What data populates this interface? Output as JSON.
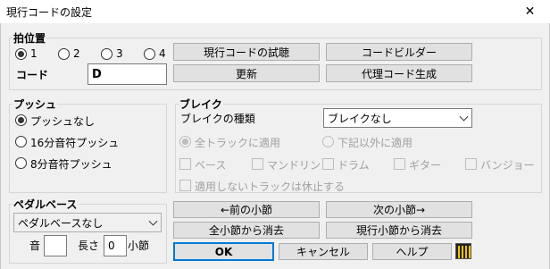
{
  "window": {
    "title": "現行コードの設定",
    "close_glyph": "✕"
  },
  "beat_position": {
    "group_label": "拍位置",
    "options": [
      "1",
      "2",
      "3",
      "4"
    ],
    "selected_index": 0,
    "code_label": "コード",
    "code_value": "D"
  },
  "top_buttons": {
    "trial": "現行コードの試聴",
    "code_builder": "コードビルダー",
    "update": "更新",
    "substitute": "代理コード生成"
  },
  "push": {
    "group_label": "プッシュ",
    "options": [
      "プッシュなし",
      "16分音符プッシュ",
      "8分音符プッシュ"
    ],
    "selected_index": 0
  },
  "break": {
    "group_label": "ブレイク",
    "type_label": "ブレイクの種類",
    "type_value": "ブレイクなし",
    "scope_options": [
      "全トラックに適用",
      "下記以外に適用"
    ],
    "scope_selected_index": 0,
    "tracks": [
      "ベース",
      "マンドリン",
      "ドラム",
      "ギター",
      "バンジョー"
    ],
    "rest_label": "適用しないトラックは休止する"
  },
  "pedal_bass": {
    "group_label": "ペダルベース",
    "select_value": "ペダルベースなし",
    "note_label": "音",
    "note_value": "",
    "length_label": "長さ",
    "length_value": "0",
    "measure_label": "小節"
  },
  "nav_buttons": {
    "prev_measure": "←前の小節",
    "next_measure": "次の小節→",
    "delete_from_all": "全小節から消去",
    "delete_from_current": "現行小節から消去"
  },
  "dialog_buttons": {
    "ok": "OK",
    "cancel": "キャンセル",
    "help": "ヘルプ"
  },
  "colors": {
    "accent": "#0078d7",
    "background": "#f0f0f0"
  }
}
